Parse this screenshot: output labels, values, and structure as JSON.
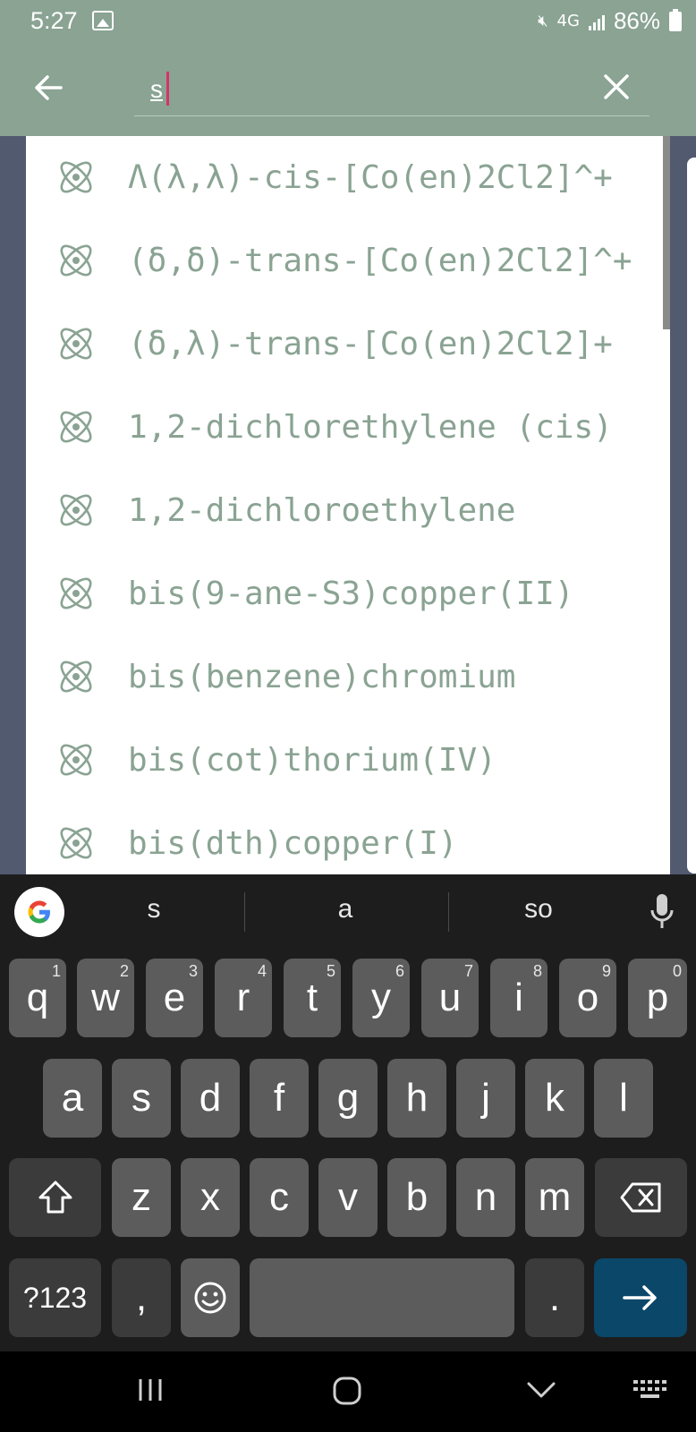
{
  "status_bar": {
    "time": "5:27",
    "network": "4G",
    "battery": "86%"
  },
  "search": {
    "query": "s"
  },
  "suggestions": [
    {
      "label": "Λ(λ,λ)-cis-[Co(en)2Cl2]^+"
    },
    {
      "label": "(δ,δ)-trans-[Co(en)2Cl2]^+"
    },
    {
      "label": "(δ,λ)-trans-[Co(en)2Cl2]+"
    },
    {
      "label": "1,2-dichlorethylene (cis)"
    },
    {
      "label": "1,2-dichloroethylene"
    },
    {
      "label": "bis(9-ane-S3)copper(II)"
    },
    {
      "label": "bis(benzene)chromium"
    },
    {
      "label": "bis(cot)thorium(IV)"
    },
    {
      "label": "bis(dth)copper(I)"
    }
  ],
  "keyboard": {
    "suggestions": [
      "s",
      "a",
      "so"
    ],
    "row1": [
      {
        "key": "q",
        "num": "1"
      },
      {
        "key": "w",
        "num": "2"
      },
      {
        "key": "e",
        "num": "3"
      },
      {
        "key": "r",
        "num": "4"
      },
      {
        "key": "t",
        "num": "5"
      },
      {
        "key": "y",
        "num": "6"
      },
      {
        "key": "u",
        "num": "7"
      },
      {
        "key": "i",
        "num": "8"
      },
      {
        "key": "o",
        "num": "9"
      },
      {
        "key": "p",
        "num": "0"
      }
    ],
    "row2": [
      "a",
      "s",
      "d",
      "f",
      "g",
      "h",
      "j",
      "k",
      "l"
    ],
    "row3": [
      "z",
      "x",
      "c",
      "v",
      "b",
      "n",
      "m"
    ],
    "symbols_label": "?123",
    "comma": ",",
    "period": "."
  },
  "colors": {
    "accent": "#8aa393",
    "caret": "#d6336c",
    "enter_key": "#0b4769"
  },
  "icons": [
    "back-arrow-icon",
    "close-icon",
    "atom-icon",
    "google-icon",
    "mic-icon",
    "shift-icon",
    "backspace-icon",
    "emoji-icon",
    "enter-arrow-icon",
    "recents-icon",
    "home-icon",
    "back-chevron-icon",
    "keyboard-icon"
  ]
}
